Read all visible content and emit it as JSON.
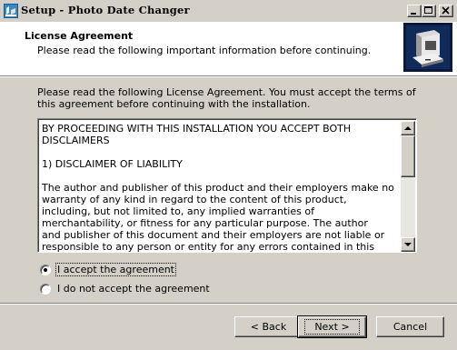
{
  "window": {
    "title": "Setup - Photo Date Changer"
  },
  "header": {
    "title": "License Agreement",
    "subtitle": "Please read the following important information before continuing."
  },
  "intro_text": "Please read the following License Agreement. You must accept the terms of this agreement before continuing with the installation.",
  "license_text": "BY PROCEEDING WITH THIS INSTALLATION YOU ACCEPT BOTH DISCLAIMERS\n\n1) DISCLAIMER OF LIABILITY\n\nThe author and publisher of this product and their employers make no\nwarranty of any kind in regard to the content of this product,\nincluding, but not limited to, any implied warranties of\nmerchantability, or fitness for any particular purpose. The author\nand publisher of this document and their employers are not liable or\nresponsible to any person or entity for any errors contained in this\nproduct, or for any special, incidental, or consequential damage",
  "options": {
    "accept": {
      "label": "I accept the agreement",
      "selected": true
    },
    "decline": {
      "label": "I do not accept the agreement",
      "selected": false
    }
  },
  "buttons": {
    "back": "< Back",
    "next": "Next >",
    "cancel": "Cancel"
  },
  "icons": {
    "app": "setup-app-icon",
    "header": "computer-installer-icon",
    "minimize": "minimize-icon",
    "maximize": "maximize-icon",
    "close": "close-icon",
    "scroll_up": "scroll-up-arrow-icon",
    "scroll_down": "scroll-down-arrow-icon"
  },
  "colors": {
    "face": "#d4d0c8",
    "header_bg": "#ffffff",
    "header_image_bg": "#0a1a3c"
  }
}
